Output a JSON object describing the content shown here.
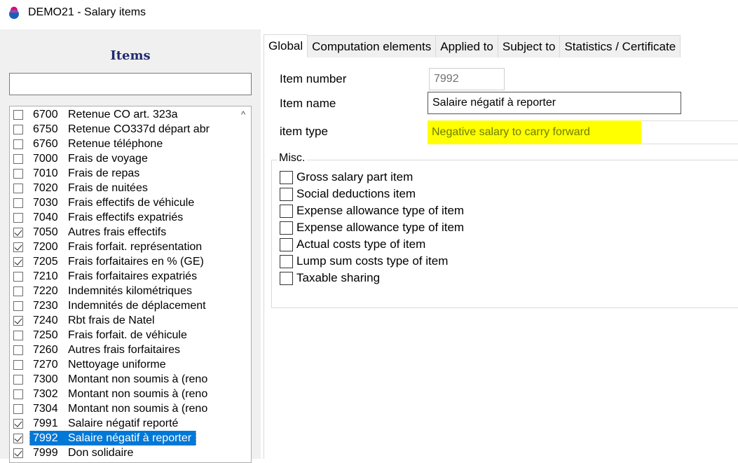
{
  "window": {
    "title": "DEMO21 - Salary items"
  },
  "left": {
    "heading": "Items",
    "search_value": "",
    "scroll_up_glyph": "^",
    "items": [
      {
        "num": "6700",
        "label": "Retenue CO art. 323a",
        "checked": false,
        "selected": false
      },
      {
        "num": "6750",
        "label": "Retenue CO337d départ abr",
        "checked": false,
        "selected": false
      },
      {
        "num": "6760",
        "label": "Retenue téléphone",
        "checked": false,
        "selected": false
      },
      {
        "num": "7000",
        "label": "Frais de voyage",
        "checked": false,
        "selected": false
      },
      {
        "num": "7010",
        "label": "Frais de repas",
        "checked": false,
        "selected": false
      },
      {
        "num": "7020",
        "label": "Frais de nuitées",
        "checked": false,
        "selected": false
      },
      {
        "num": "7030",
        "label": "Frais effectifs de véhicule",
        "checked": false,
        "selected": false
      },
      {
        "num": "7040",
        "label": "Frais effectifs expatriés",
        "checked": false,
        "selected": false
      },
      {
        "num": "7050",
        "label": "Autres frais effectifs",
        "checked": true,
        "selected": false
      },
      {
        "num": "7200",
        "label": "Frais forfait. représentation",
        "checked": true,
        "selected": false
      },
      {
        "num": "7205",
        "label": "Frais forfaitaires en % (GE)",
        "checked": true,
        "selected": false
      },
      {
        "num": "7210",
        "label": "Frais forfaitaires expatriés",
        "checked": false,
        "selected": false
      },
      {
        "num": "7220",
        "label": "Indemnités kilométriques",
        "checked": false,
        "selected": false
      },
      {
        "num": "7230",
        "label": "Indemnités de déplacement",
        "checked": false,
        "selected": false
      },
      {
        "num": "7240",
        "label": "Rbt frais de Natel",
        "checked": true,
        "selected": false
      },
      {
        "num": "7250",
        "label": "Frais forfait. de véhicule",
        "checked": false,
        "selected": false
      },
      {
        "num": "7260",
        "label": "Autres frais forfaitaires",
        "checked": false,
        "selected": false
      },
      {
        "num": "7270",
        "label": "Nettoyage uniforme",
        "checked": false,
        "selected": false
      },
      {
        "num": "7300",
        "label": "Montant non soumis à (reno",
        "checked": false,
        "selected": false
      },
      {
        "num": "7302",
        "label": "Montant non soumis à (reno",
        "checked": false,
        "selected": false
      },
      {
        "num": "7304",
        "label": "Montant non soumis à (reno",
        "checked": false,
        "selected": false
      },
      {
        "num": "7991",
        "label": "Salaire négatif reporté",
        "checked": true,
        "selected": false
      },
      {
        "num": "7992",
        "label": "Salaire négatif à reporter",
        "checked": true,
        "selected": true
      },
      {
        "num": "7999",
        "label": "Don solidaire",
        "checked": true,
        "selected": false
      }
    ]
  },
  "tabs": [
    {
      "label": "Global",
      "active": true
    },
    {
      "label": "Computation elements",
      "active": false
    },
    {
      "label": "Applied to",
      "active": false
    },
    {
      "label": "Subject to",
      "active": false
    },
    {
      "label": "Statistics / Certificate",
      "active": false
    }
  ],
  "form": {
    "item_number_label": "Item number",
    "item_number_value": "7992",
    "item_name_label": "Item name",
    "item_name_value": "Salaire négatif à reporter",
    "item_type_label": "item type",
    "item_type_value": "Negative salary to carry forward",
    "highlight_color": "#ffff00"
  },
  "misc": {
    "legend": "Misc.",
    "options": [
      {
        "label": "Gross salary part item",
        "checked": false
      },
      {
        "label": "Social deductions item",
        "checked": false
      },
      {
        "label": "Expense allowance type of item",
        "checked": false
      },
      {
        "label": "Expense allowance type of item",
        "checked": false
      },
      {
        "label": "Actual costs type of item",
        "checked": false
      },
      {
        "label": "Lump sum costs type of item",
        "checked": false
      },
      {
        "label": "Taxable sharing",
        "checked": false
      }
    ]
  },
  "colors": {
    "selection": "#0078d7",
    "heading": "#1f2a6e",
    "panel_bg": "#f0f0f0"
  }
}
